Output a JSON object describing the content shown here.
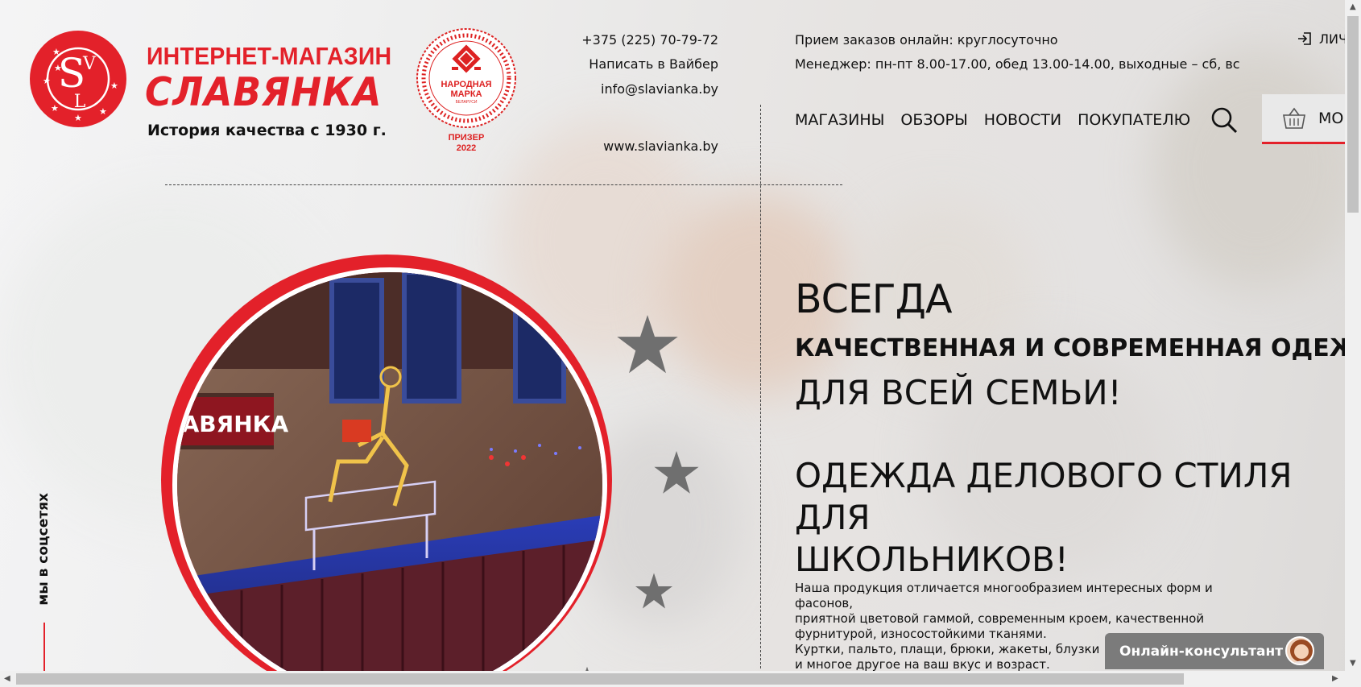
{
  "brand": {
    "line1": "ИНТЕРНЕТ-МАГАЗИН",
    "line2": "СЛАВЯНКА",
    "tagline": "История качества с 1930 г.",
    "monogram": "SVL",
    "accent_color": "#e3212a"
  },
  "badge": {
    "title_line1": "НАРОДНАЯ",
    "title_line2": "МАРКА",
    "title_line3": "БЕЛАРУСИ",
    "caption_line1": "ПРИЗЕР",
    "caption_line2": "2022"
  },
  "contacts": {
    "phone": "+375 (225) 70-79-72",
    "viber": "Написать в Вайбер",
    "email": "info@slavianka.by",
    "site": "www.slavianka.by"
  },
  "info": {
    "orders": "Прием заказов онлайн: круглосуточно",
    "manager": "Менеджер: пн-пт 8.00-17.00, обед 13.00-14.00, выходные – сб, вс"
  },
  "login": {
    "label": "ЛИЧ",
    "icon": "login-icon"
  },
  "nav": [
    {
      "label": "МАГАЗИНЫ"
    },
    {
      "label": "ОБЗОРЫ"
    },
    {
      "label": "НОВОСТИ"
    },
    {
      "label": "ПОКУПАТЕЛЮ"
    }
  ],
  "cart": {
    "label": "МО",
    "icon": "basket-icon"
  },
  "hero": {
    "storefront_sign": "СЛАВЯНКА",
    "always": "ВСЕГДА",
    "quality": "КАЧЕСТВЕННАЯ И СОВРЕМЕННАЯ ОДЕЖДА",
    "family": "ДЛЯ ВСЕЙ СЕМЬИ!",
    "business_line1": "ОДЕЖДА ДЕЛОВОГО СТИЛЯ ДЛЯ",
    "business_line2": "ШКОЛЬНИКОВ!",
    "desc_line1": "Наша продукция отличается многообразием интересных форм и фасонов,",
    "desc_line2": "приятной цветовой гаммой, современным кроем, качественной",
    "desc_line3": "фурнитурой, износостойкими тканями.",
    "desc_line4": "Куртки, пальто, плащи, брюки, жакеты, блузки",
    "desc_line5": "и многое другое на ваш вкус и возраст."
  },
  "social": {
    "label": "мы в соцсетях"
  },
  "consultant": {
    "label": "Онлайн-консультант"
  }
}
